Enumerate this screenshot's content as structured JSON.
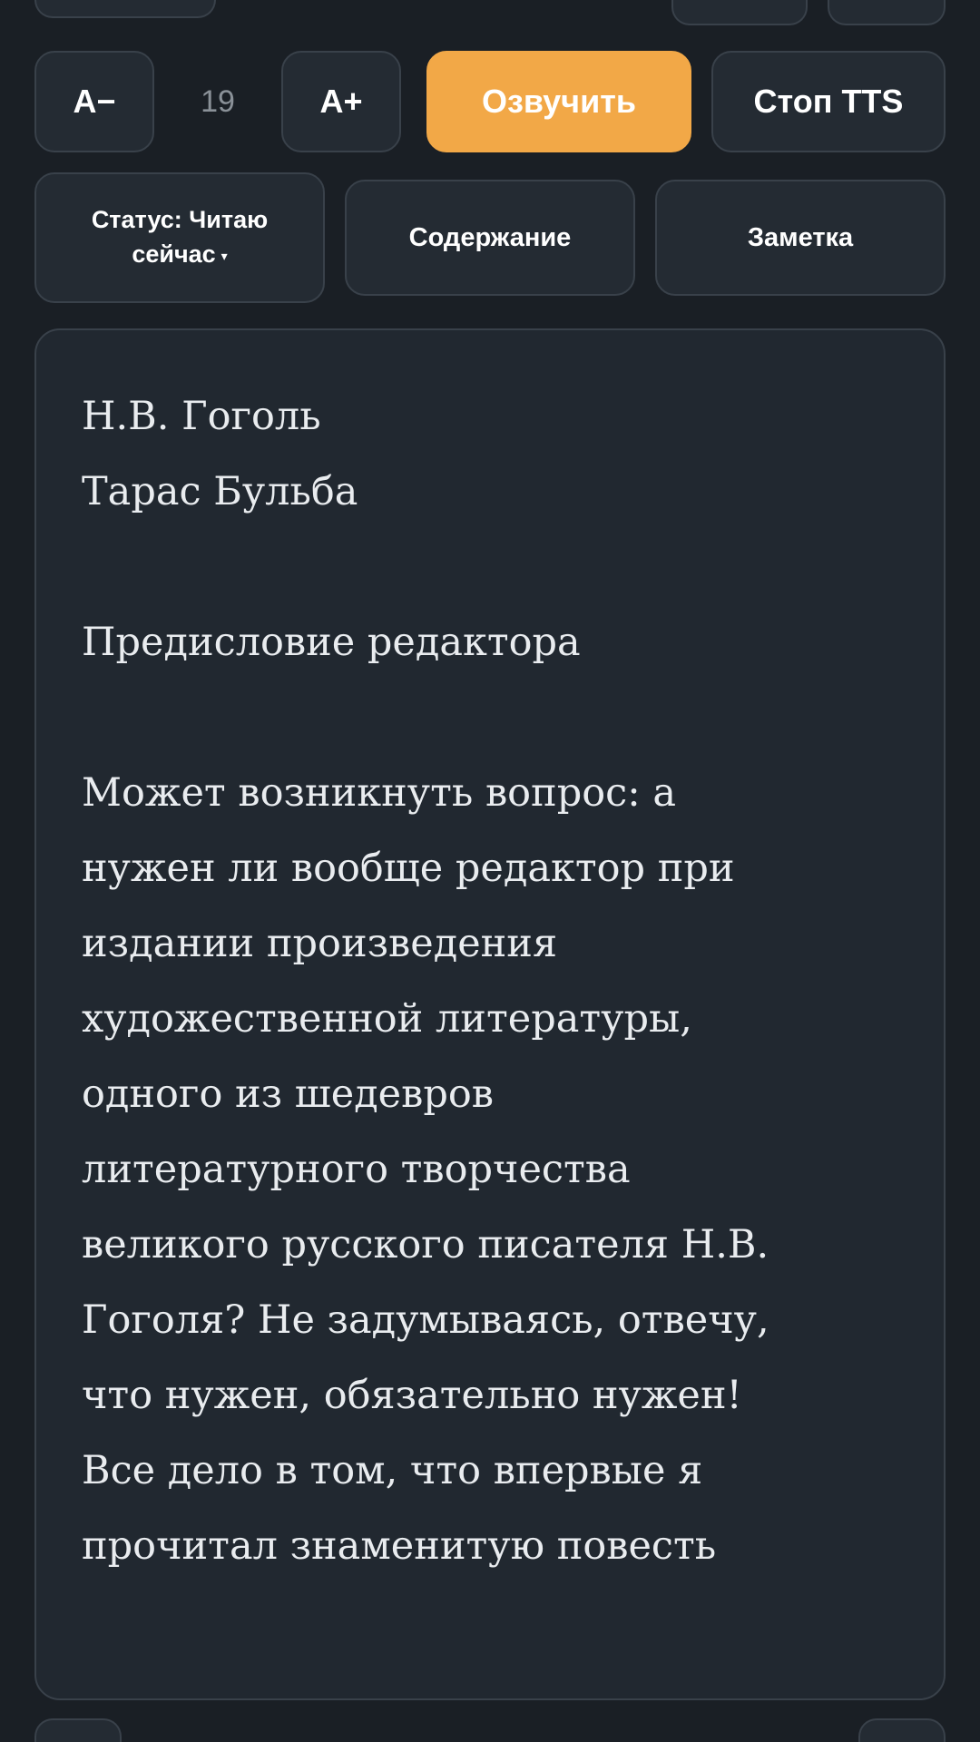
{
  "toolbar": {
    "decrease_label": "A−",
    "font_size": "19",
    "increase_label": "A+",
    "speak_label": "Озвучить",
    "stop_tts_label": "Стоп TTS"
  },
  "actions": {
    "status_label": "Статус: Читаю сейчас",
    "status_caret": "▾",
    "contents_label": "Содержание",
    "note_label": "Заметка"
  },
  "reader": {
    "text": "Н.В. Гоголь\nТарас Бульба\n\nПредисловие редактора\n\nМожет возникнуть вопрос: а\nнужен ли вообще редактор при\nиздании произведения\nхудожественной литературы,\nодного из шедевров\nлитературного творчества\nвеликого русского писателя Н.В.\nГоголя? Не задумываясь, отвечу,\nчто нужен, обязательно нужен!\nВсе дело в том, что впервые я\nпрочитал знаменитую повесть"
  },
  "colors": {
    "background": "#1a1f25",
    "button": "#242b33",
    "accent": "#f2a847"
  }
}
